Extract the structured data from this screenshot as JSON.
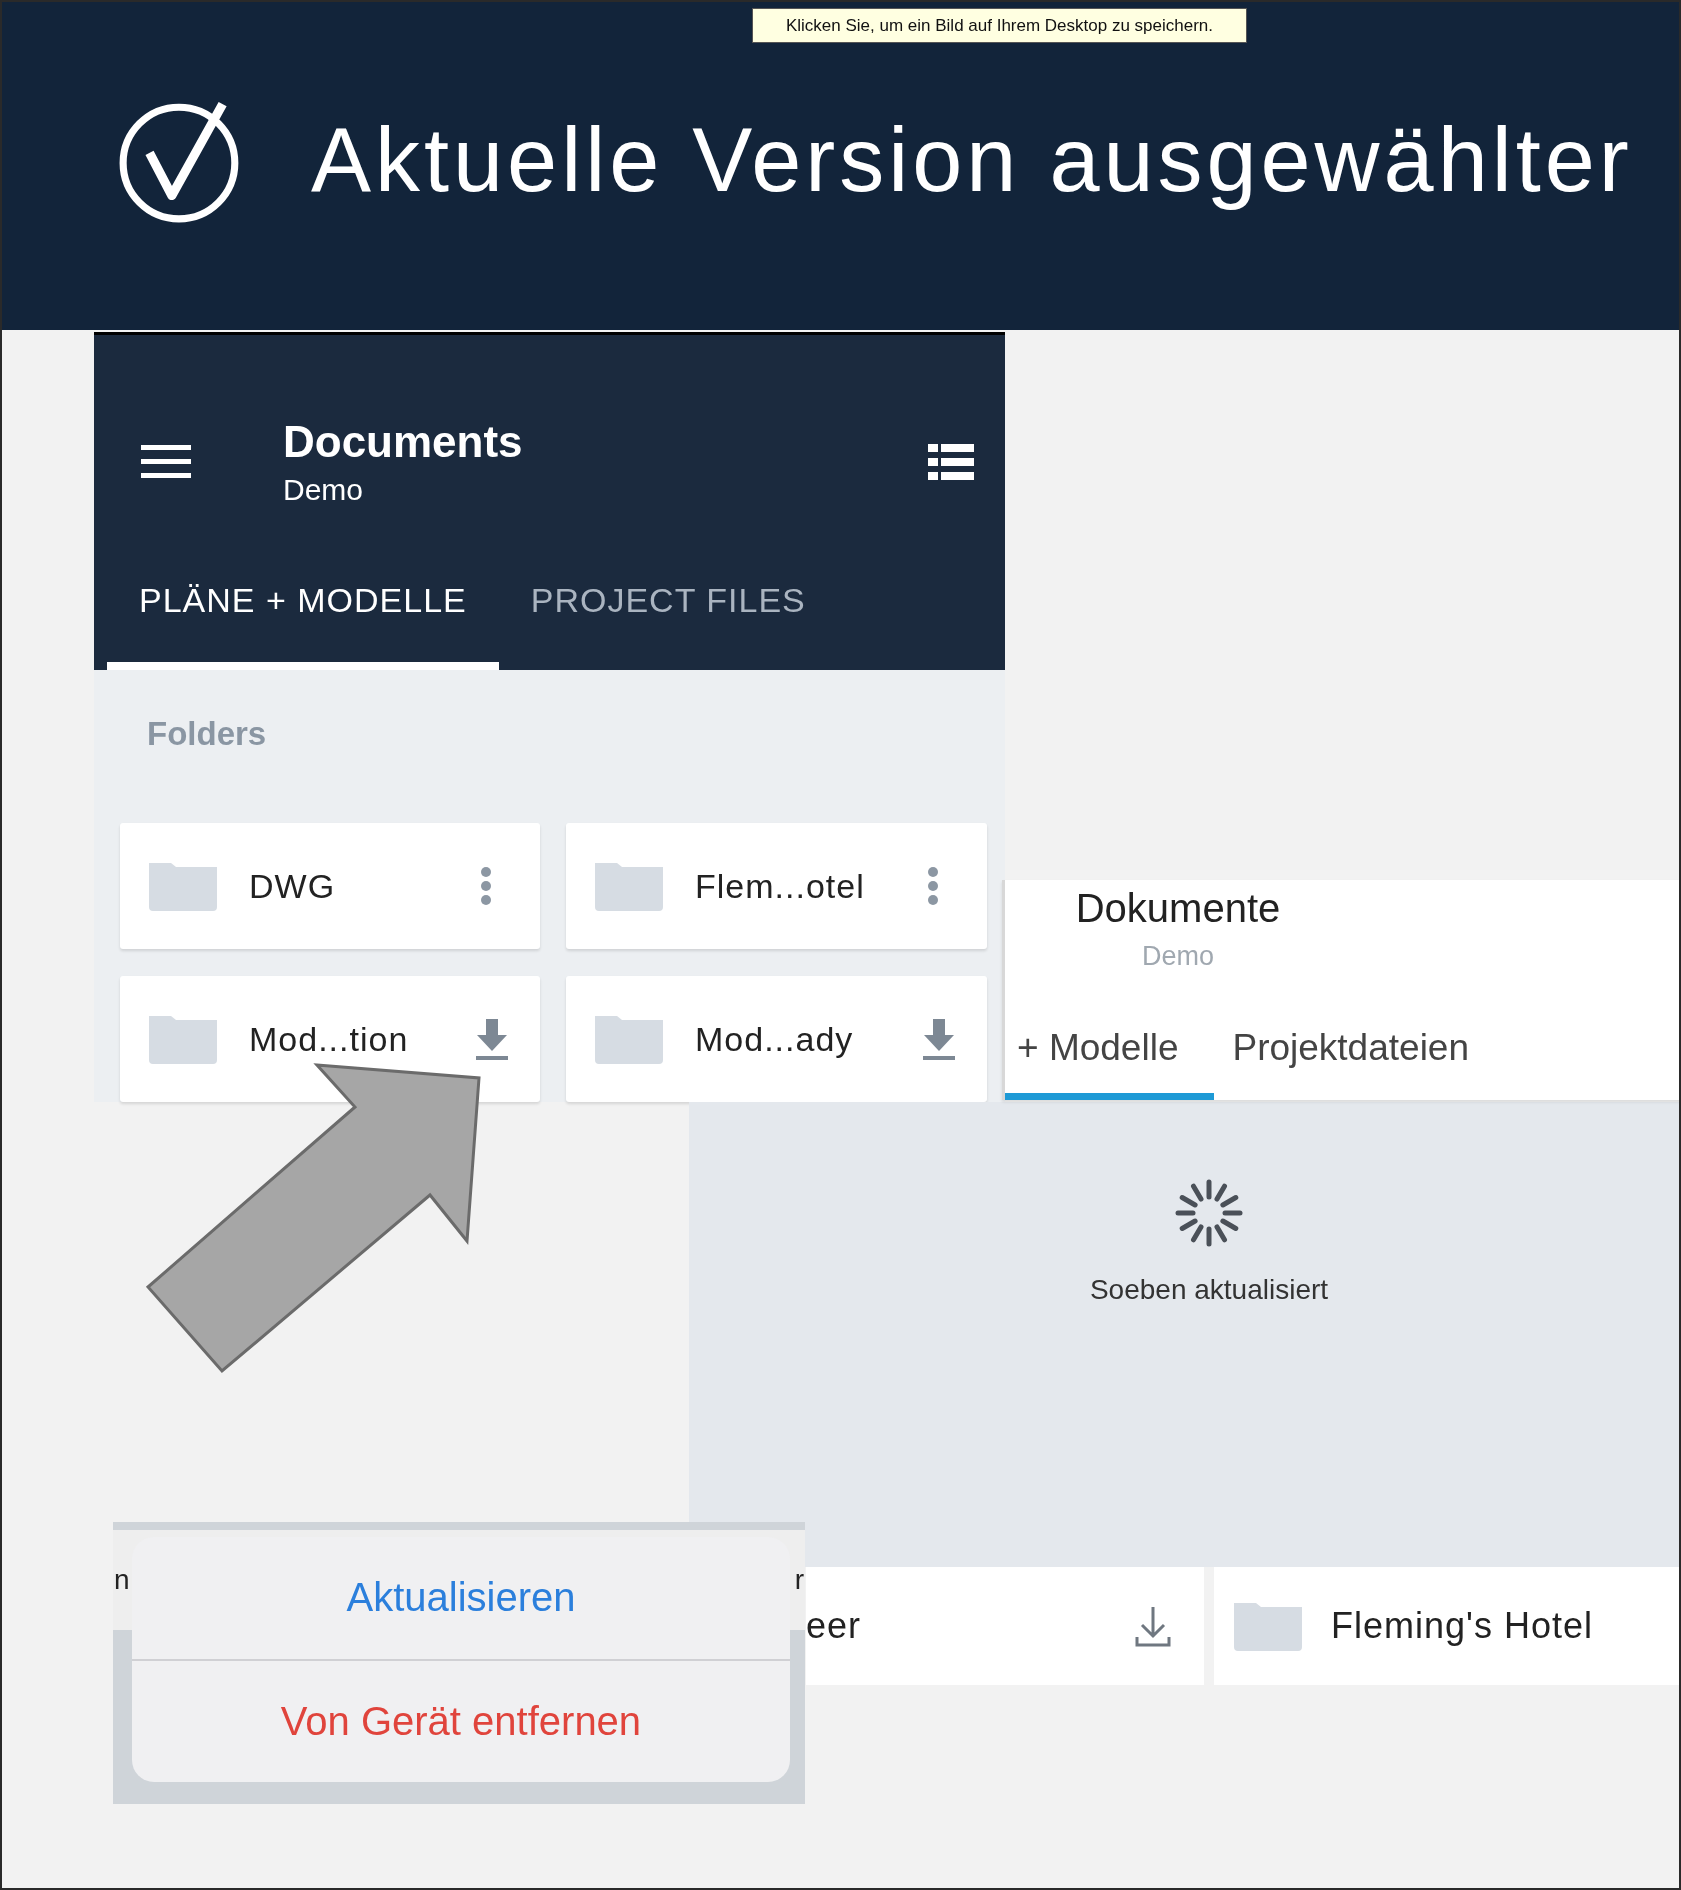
{
  "tooltip": {
    "text": "Klicken Sie, um ein Bild auf Ihrem Desktop zu speichern."
  },
  "header": {
    "title": "Aktuelle Version ausgewählter"
  },
  "left_screen": {
    "title": "Documents",
    "subtitle": "Demo",
    "tabs": [
      {
        "label": "PLÄNE + MODELLE",
        "selected": true
      },
      {
        "label": "PROJECT FILES",
        "selected": false
      }
    ],
    "section_label": "Folders",
    "folders": [
      {
        "name": "DWG",
        "kind": "more"
      },
      {
        "name": "Flem...otel",
        "kind": "more"
      },
      {
        "name": "Mod...tion",
        "kind": "download"
      },
      {
        "name": "Mod...ady",
        "kind": "download"
      }
    ]
  },
  "right_screen": {
    "title": "Dokumente",
    "subtitle": "Demo",
    "tabs": [
      {
        "label": "+ Modelle",
        "selected": true
      },
      {
        "label": "Projektdateien",
        "selected": false
      }
    ],
    "status": "Soeben aktualisiert",
    "files": [
      {
        "name": "eer",
        "kind": "download"
      },
      {
        "name": "Fleming's Hotel",
        "kind": "folder"
      }
    ]
  },
  "action_sheet": {
    "fragments": [
      "n",
      "r"
    ],
    "actions": [
      {
        "label": "Aktualisieren",
        "kind": "default"
      },
      {
        "label": "Von Gerät entfernen",
        "kind": "destructive"
      }
    ]
  }
}
